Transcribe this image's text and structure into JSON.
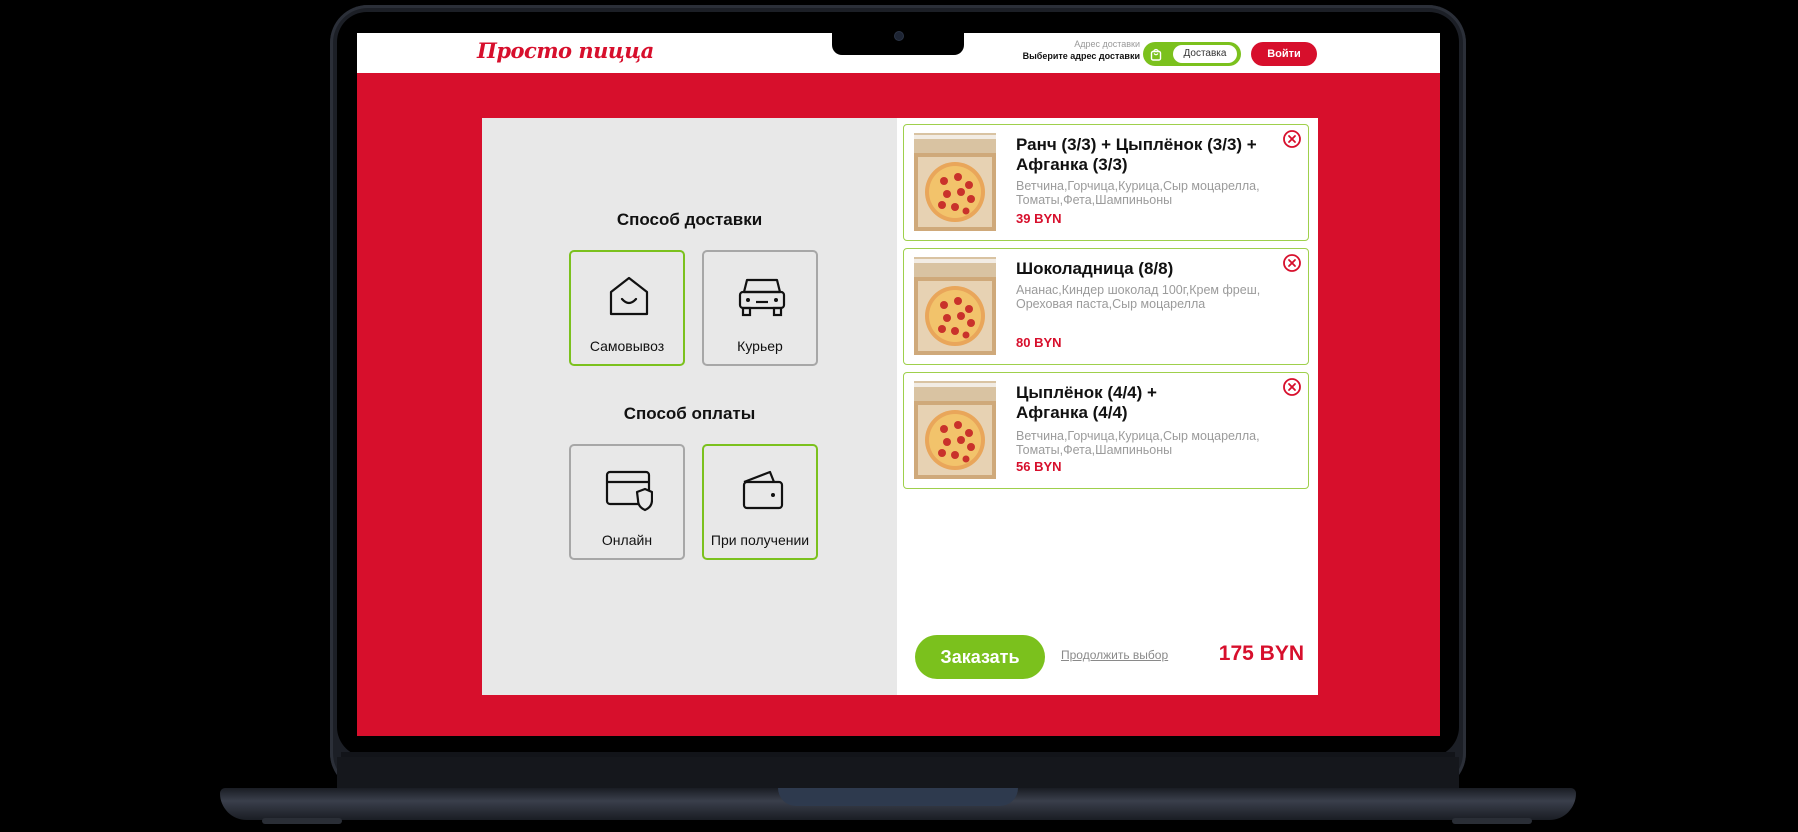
{
  "header": {
    "logo": "Просто пицца",
    "address_label": "Адрес доставки",
    "address_value": "Выберите адрес доставки",
    "toggle_label": "Доставка",
    "login_label": "Войти"
  },
  "colors": {
    "brand_red": "#d70f2c",
    "accent_green": "#7bc11d"
  },
  "delivery": {
    "title": "Способ доставки",
    "options": [
      {
        "label": "Самовывоз",
        "icon": "house-icon",
        "selected": true
      },
      {
        "label": "Курьер",
        "icon": "car-icon",
        "selected": false
      }
    ]
  },
  "payment": {
    "title": "Способ оплаты",
    "options": [
      {
        "label": "Онлайн",
        "icon": "card-shield-icon",
        "selected": false
      },
      {
        "label": "При получении",
        "icon": "wallet-icon",
        "selected": true
      }
    ]
  },
  "cart": {
    "items": [
      {
        "title": "Ранч (3/3) + Цыплёнок (3/3) + Афганка (3/3)",
        "ingredients": "Ветчина,Горчица,Курица,Сыр моцарелла, Томаты,Фета,Шампиньоны",
        "price": "39 BYN"
      },
      {
        "title": "Шоколадница (8/8)",
        "ingredients": "Ананас,Киндер шоколад 100г,Крем фреш, Ореховая паста,Сыр моцарелла",
        "price": "80 BYN"
      },
      {
        "title": "Цыплёнок (4/4) + Афганка (4/4)",
        "ingredients": "Ветчина,Горчица,Курица,Сыр моцарелла, Томаты,Фета,Шампиньоны",
        "price": "56 BYN"
      }
    ],
    "order_label": "Заказать",
    "continue_label": "Продолжить выбор",
    "total": "175 BYN"
  }
}
